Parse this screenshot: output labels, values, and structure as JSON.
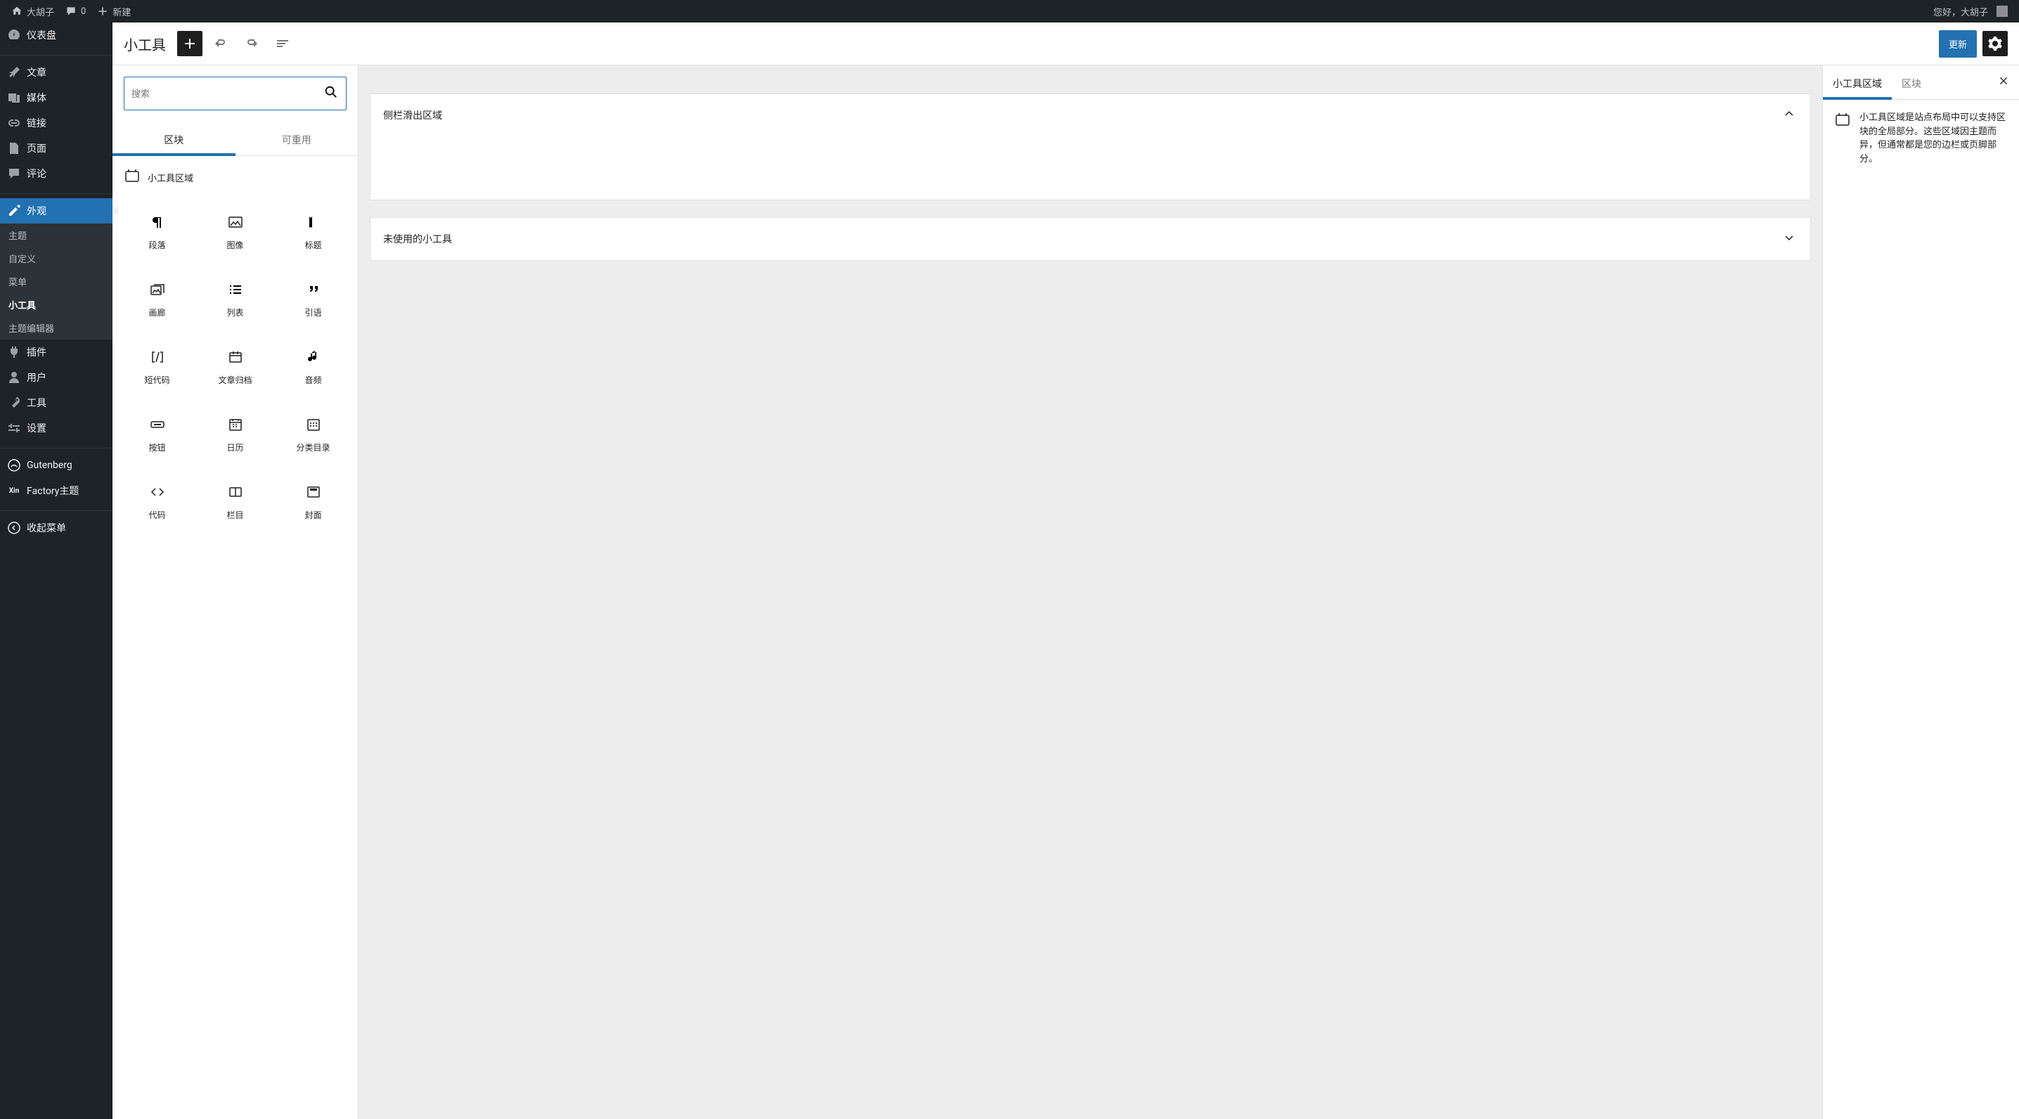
{
  "topbar": {
    "site_name": "大胡子",
    "comments_count": "0",
    "new_label": "新建",
    "greeting": "您好，大胡子"
  },
  "sidebar": {
    "items": [
      {
        "label": "仪表盘",
        "icon": "dashboard"
      },
      {
        "label": "文章",
        "icon": "pin"
      },
      {
        "label": "媒体",
        "icon": "media"
      },
      {
        "label": "链接",
        "icon": "link"
      },
      {
        "label": "页面",
        "icon": "page"
      },
      {
        "label": "评论",
        "icon": "comment"
      },
      {
        "label": "外观",
        "icon": "appearance",
        "active": true
      },
      {
        "label": "插件",
        "icon": "plugin"
      },
      {
        "label": "用户",
        "icon": "user"
      },
      {
        "label": "工具",
        "icon": "tool"
      },
      {
        "label": "设置",
        "icon": "settings"
      },
      {
        "label": "Gutenberg",
        "icon": "gutenberg"
      },
      {
        "label": "Factory主题",
        "icon": "xin"
      },
      {
        "label": "收起菜单",
        "icon": "collapse"
      }
    ],
    "submenu": [
      {
        "label": "主题"
      },
      {
        "label": "自定义"
      },
      {
        "label": "菜单"
      },
      {
        "label": "小工具",
        "current": true
      },
      {
        "label": "主题编辑器"
      }
    ]
  },
  "editor": {
    "title": "小工具",
    "update_label": "更新"
  },
  "inserter": {
    "search_placeholder": "搜索",
    "tabs": {
      "blocks": "区块",
      "reusable": "可重用"
    },
    "category_label": "小工具区域",
    "blocks": [
      {
        "id": "paragraph",
        "label": "段落"
      },
      {
        "id": "image",
        "label": "图像"
      },
      {
        "id": "heading",
        "label": "标题"
      },
      {
        "id": "gallery",
        "label": "画廊"
      },
      {
        "id": "list",
        "label": "列表"
      },
      {
        "id": "quote",
        "label": "引语"
      },
      {
        "id": "shortcode",
        "label": "短代码"
      },
      {
        "id": "archives",
        "label": "文章归档"
      },
      {
        "id": "audio",
        "label": "音频"
      },
      {
        "id": "button",
        "label": "按钮"
      },
      {
        "id": "calendar",
        "label": "日历"
      },
      {
        "id": "categories",
        "label": "分类目录"
      },
      {
        "id": "code",
        "label": "代码"
      },
      {
        "id": "columns",
        "label": "栏目"
      },
      {
        "id": "cover",
        "label": "封面"
      }
    ]
  },
  "canvas": {
    "areas": [
      {
        "title": "侧栏滑出区域",
        "expanded": true
      },
      {
        "title": "未使用的小工具",
        "expanded": false
      }
    ]
  },
  "settings_panel": {
    "tabs": {
      "widget_area": "小工具区域",
      "block": "区块"
    },
    "description": "小工具区域是站点布局中可以支持区块的全局部分。这些区域因主题而异，但通常都是您的边栏或页脚部分。"
  }
}
